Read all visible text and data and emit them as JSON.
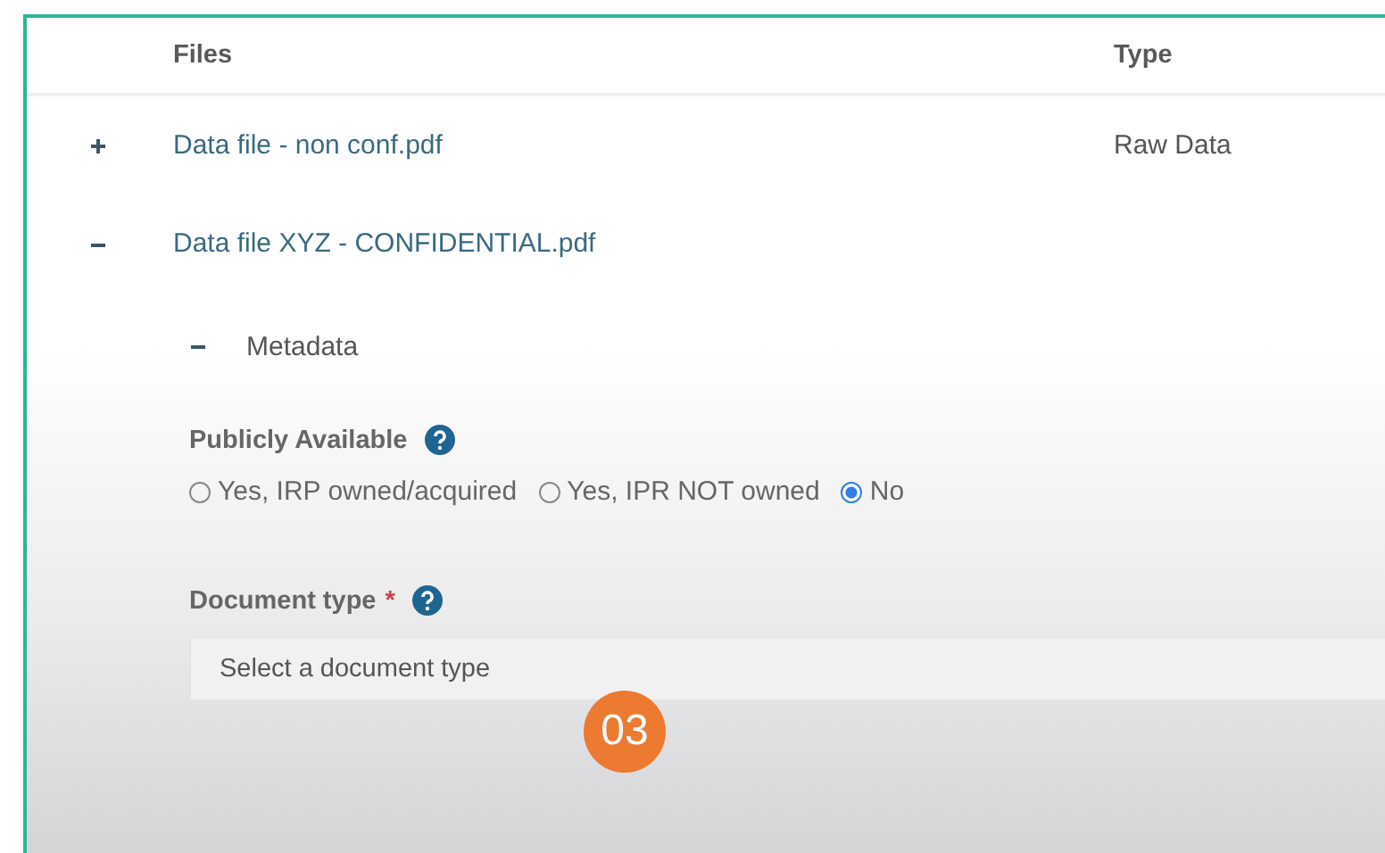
{
  "table": {
    "columns": [
      "Files",
      "Type"
    ],
    "rows": [
      {
        "name": "Data file - non conf.pdf",
        "type": "Raw Data",
        "expanded": false
      },
      {
        "name": "Data file XYZ - CONFIDENTIAL.pdf",
        "expanded": true
      }
    ]
  },
  "metadata": {
    "label": "Metadata",
    "expanded": true
  },
  "publicly_available": {
    "label": "Publicly Available",
    "options": [
      {
        "label": "Yes, IRP owned/acquired",
        "selected": false
      },
      {
        "label": "Yes, IPR NOT owned",
        "selected": false
      },
      {
        "label": "No",
        "selected": true
      }
    ]
  },
  "document_type": {
    "label": "Document type",
    "required_mark": "*",
    "placeholder": "Select a document type"
  },
  "step_badge": "03"
}
